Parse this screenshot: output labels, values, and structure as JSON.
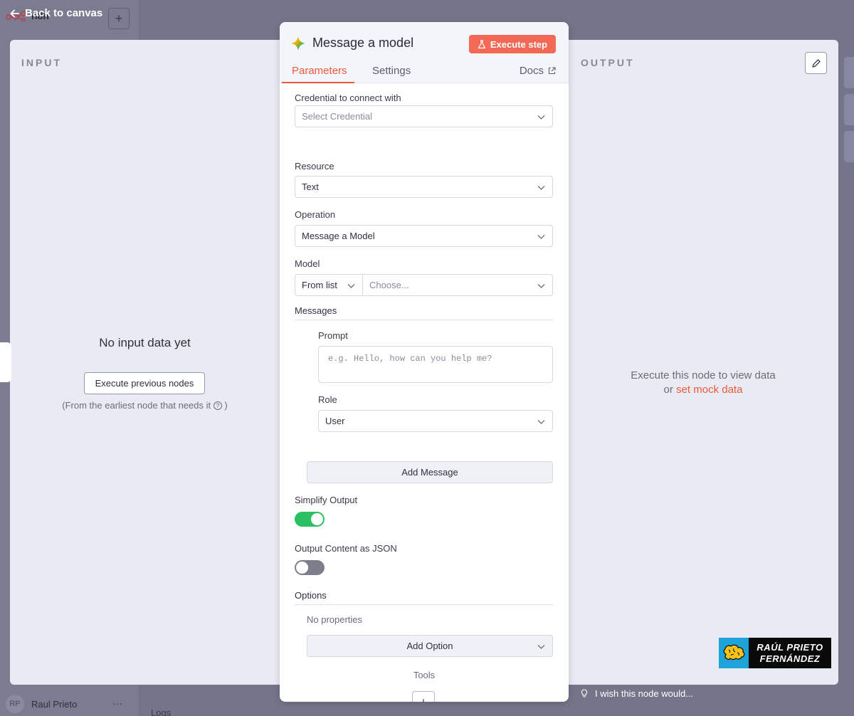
{
  "background": {
    "app_name": "n8n",
    "user_initials": "RP",
    "user_name": "Raul Prieto",
    "more": "···",
    "logs_label": "Logs",
    "plus": "+"
  },
  "back_link": {
    "label": "Back to canvas",
    "icon": "arrow-left-icon"
  },
  "input_pane": {
    "title": "INPUT",
    "empty_title": "No input data yet",
    "execute_previous_label": "Execute previous nodes",
    "hint_text": "(From the earliest node that needs it",
    "hint_close": ")",
    "hint_icon": "?"
  },
  "output_pane": {
    "title": "OUTPUT",
    "message_line1": "Execute this node to view data",
    "message_or": "or",
    "mock_link": "set mock data"
  },
  "node": {
    "title": "Message a model",
    "execute_step_label": "Execute step",
    "tabs": {
      "parameters": "Parameters",
      "settings": "Settings",
      "docs": "Docs"
    },
    "accent": "#ea5a3a"
  },
  "form": {
    "credential": {
      "label": "Credential to connect with",
      "placeholder": "Select Credential"
    },
    "resource": {
      "label": "Resource",
      "value": "Text"
    },
    "operation": {
      "label": "Operation",
      "value": "Message a Model"
    },
    "model": {
      "label": "Model",
      "mode": "From list",
      "placeholder": "Choose..."
    },
    "messages": {
      "label": "Messages",
      "prompt_label": "Prompt",
      "prompt_placeholder": "e.g. Hello, how can you help me?",
      "role_label": "Role",
      "role_value": "User",
      "add_message_label": "Add Message"
    },
    "simplify_output": {
      "label": "Simplify Output",
      "enabled": true
    },
    "output_json": {
      "label": "Output Content as JSON",
      "enabled": false
    },
    "options": {
      "label": "Options",
      "empty_text": "No properties",
      "add_option_label": "Add Option"
    },
    "tools": {
      "label": "Tools",
      "add": "+"
    }
  },
  "footer": {
    "wish_label": "I wish this node would..."
  },
  "watermark": {
    "line1": "RAÚL PRIETO",
    "line2": "FERNÁNDEZ"
  }
}
